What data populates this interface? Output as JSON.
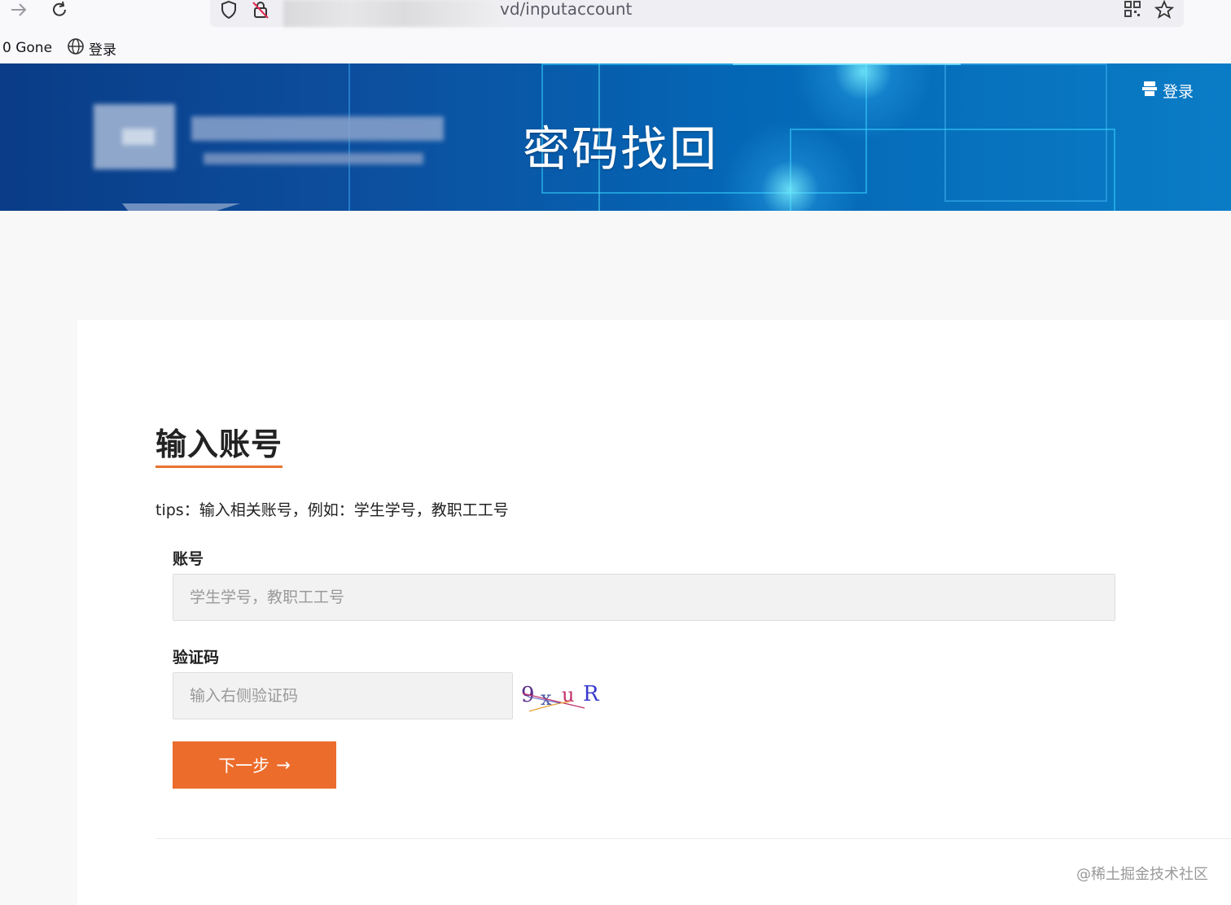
{
  "browser": {
    "url_visible": "vd/inputaccount",
    "bookmarks": [
      {
        "label": "0 Gone"
      },
      {
        "label": "登录"
      }
    ]
  },
  "header": {
    "title": "密码找回",
    "login_label": "登录"
  },
  "form": {
    "heading": "输入账号",
    "tips": "tips：输入相关账号，例如：学生学号，教职工工号",
    "account_label": "账号",
    "account_placeholder": "学生学号，教职工工号",
    "account_value": "",
    "captcha_label": "验证码",
    "captcha_placeholder": "输入右侧验证码",
    "captcha_value": "",
    "captcha_chars": [
      "9",
      "x",
      "u",
      "R"
    ],
    "next_label": "下一步",
    "next_arrow": "→"
  },
  "footer": {
    "watermark": "@稀土掘金技术社区"
  },
  "colors": {
    "accent": "#ec6c2c",
    "banner_dark": "#0a3c87",
    "banner_light": "#0a7cc6"
  }
}
